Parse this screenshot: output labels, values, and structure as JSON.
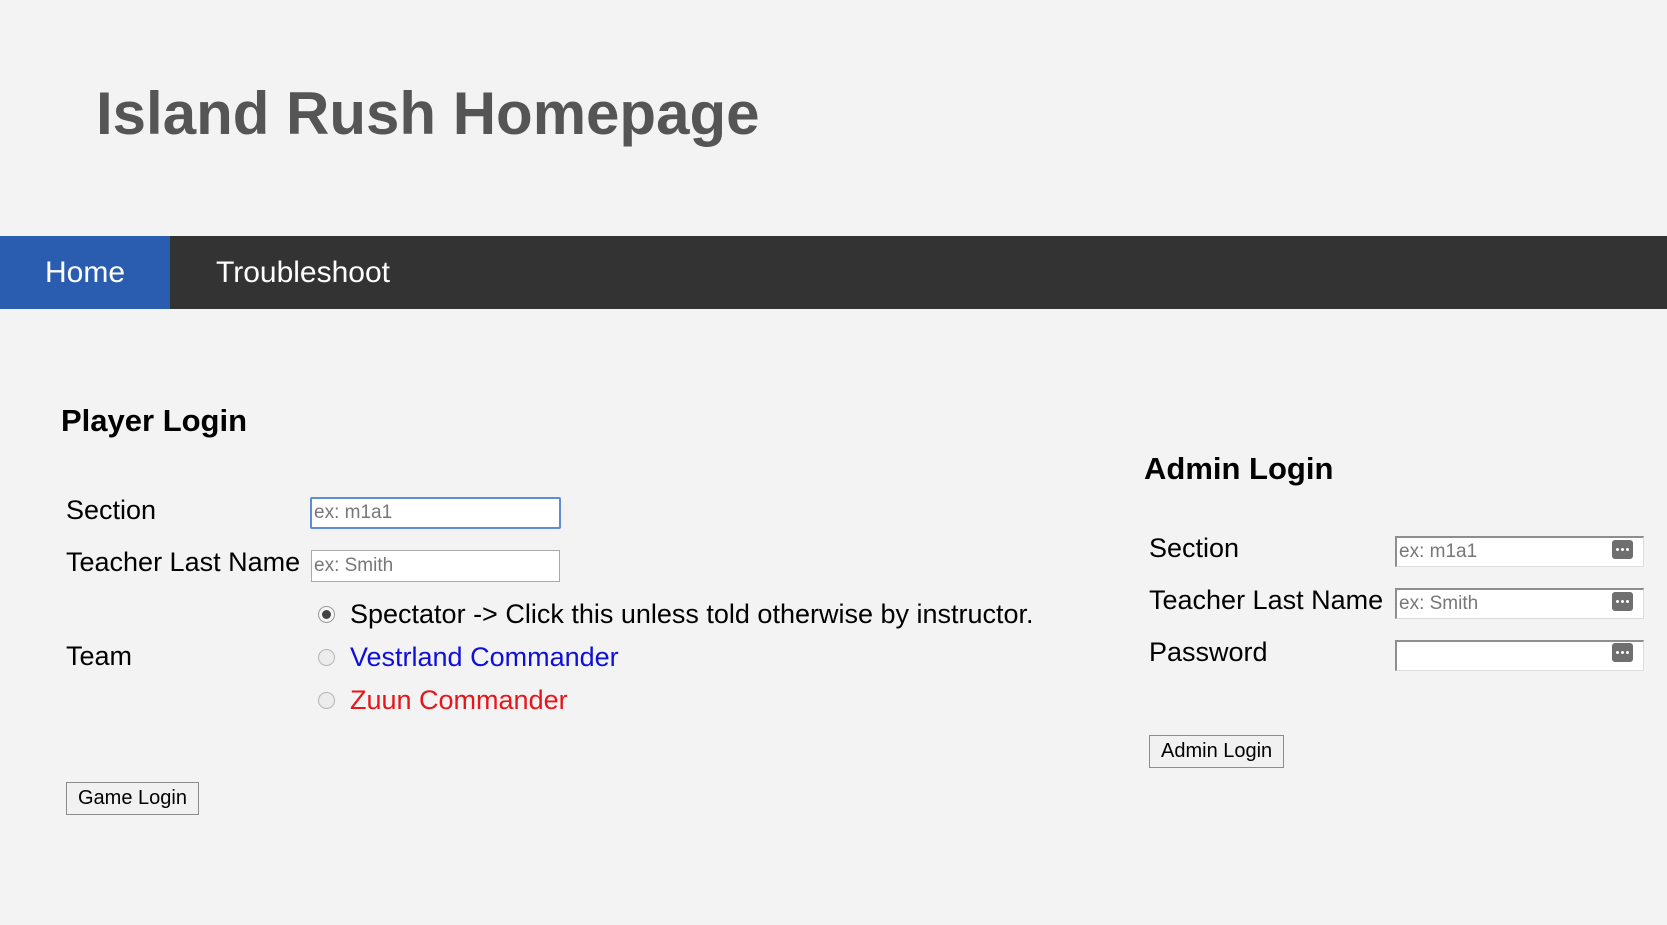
{
  "header": {
    "title": "Island Rush Homepage"
  },
  "nav": {
    "items": [
      {
        "label": "Home",
        "active": true
      },
      {
        "label": "Troubleshoot",
        "active": false
      }
    ],
    "active_color": "#2a5db0",
    "bar_color": "#333333"
  },
  "player_login": {
    "heading": "Player Login",
    "section_label": "Section",
    "section_placeholder": "ex: m1a1",
    "teacher_label": "Teacher Last Name",
    "teacher_placeholder": "ex: Smith",
    "team_label": "Team",
    "team_options": [
      {
        "label": "Spectator -> Click this unless told otherwise by instructor.",
        "color": "#000000",
        "selected": true
      },
      {
        "label": "Vestrland Commander",
        "color": "#0f0fd8",
        "selected": false
      },
      {
        "label": "Zuun Commander",
        "color": "#e8151b",
        "selected": false
      }
    ],
    "submit_label": "Game Login"
  },
  "admin_login": {
    "heading": "Admin Login",
    "section_label": "Section",
    "section_placeholder": "ex: m1a1",
    "teacher_label": "Teacher Last Name",
    "teacher_placeholder": "ex: Smith",
    "password_label": "Password",
    "password_placeholder": "",
    "field_icon": "password-manager-key-icon",
    "submit_label": "Admin Login"
  }
}
